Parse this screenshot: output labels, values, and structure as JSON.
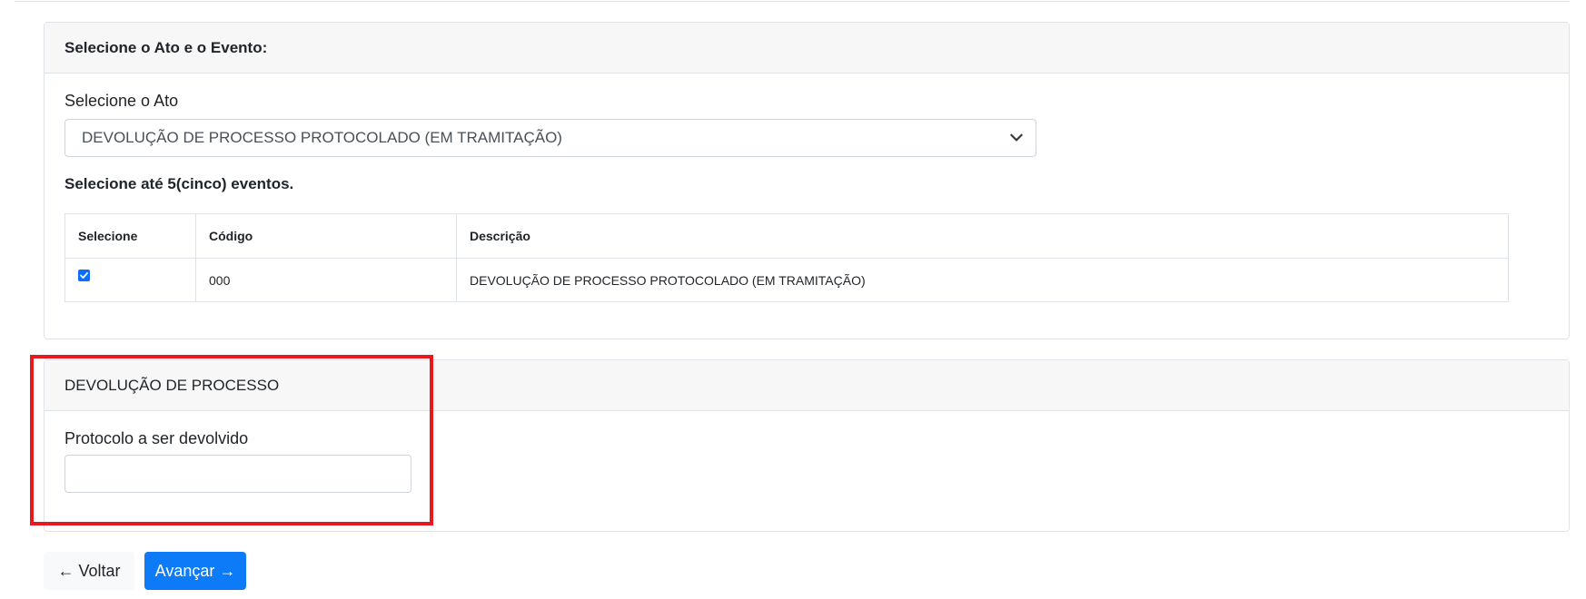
{
  "ato_card": {
    "header": "Selecione o Ato e o Evento:",
    "select_label": "Selecione o Ato",
    "select_value": "DEVOLUÇÃO DE PROCESSO PROTOCOLADO (EM TRAMITAÇÃO)",
    "events_label": "Selecione até 5(cinco) eventos.",
    "table": {
      "headers": [
        "Selecione",
        "Código",
        "Descrição"
      ],
      "rows": [
        {
          "checked": true,
          "codigo": "000",
          "descricao": "DEVOLUÇÃO DE PROCESSO PROTOCOLADO (EM TRAMITAÇÃO)"
        }
      ]
    }
  },
  "dev_card": {
    "header": "DEVOLUÇÃO DE PROCESSO",
    "input_label": "Protocolo a ser devolvido",
    "input_value": "",
    "input_placeholder": ""
  },
  "buttons": {
    "back": "← Voltar",
    "next": "Avançar →"
  },
  "colors": {
    "primary": "#0d7bf7",
    "highlight": "#e5191f",
    "header_bg": "#f7f7f7"
  }
}
